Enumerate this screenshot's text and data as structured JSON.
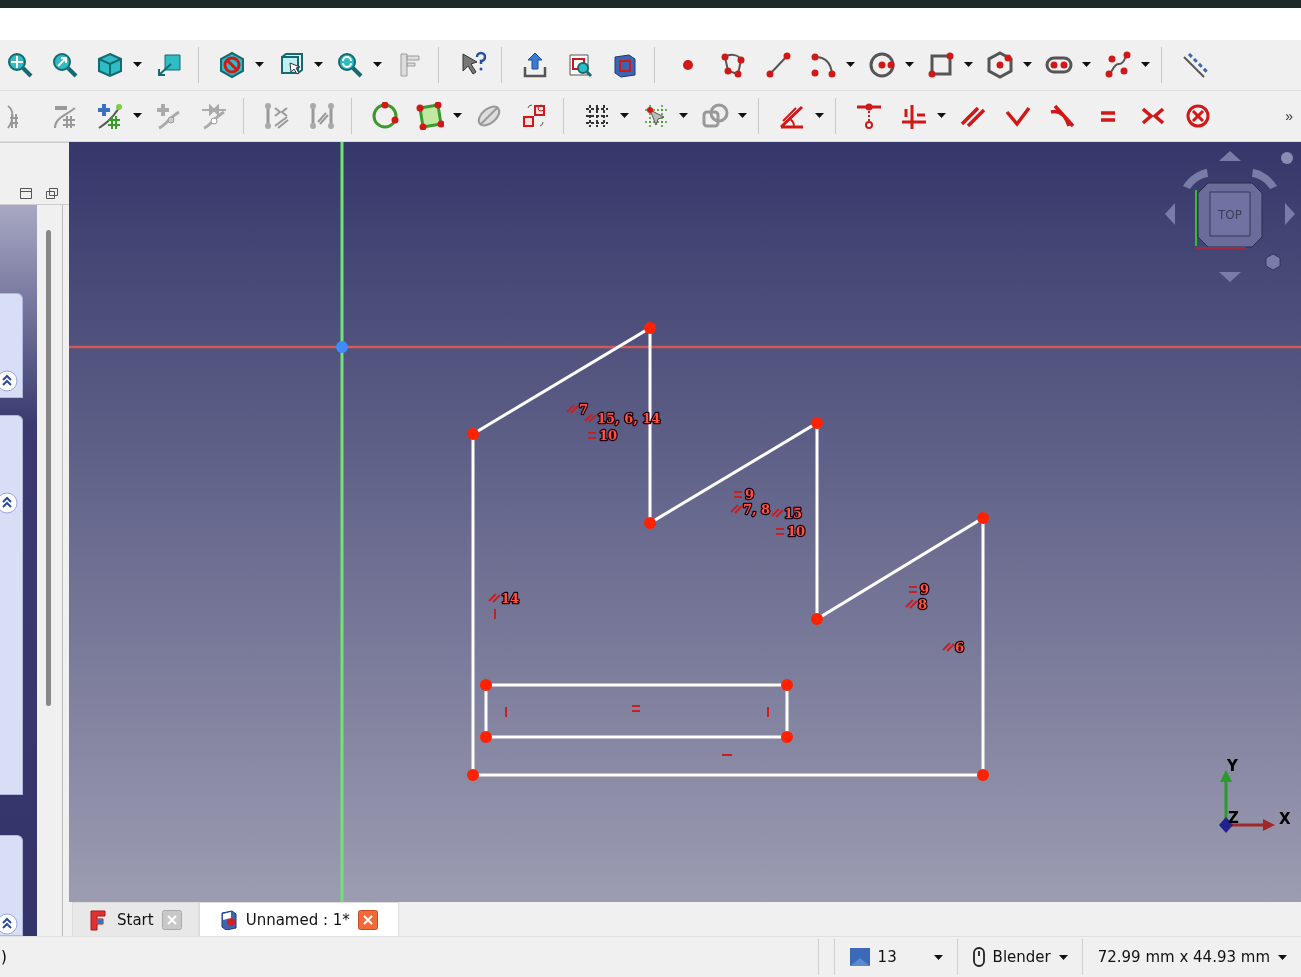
{
  "toolbar_overflow": "»",
  "sketch": {
    "constraints": [
      {
        "kind": "parallel",
        "label": "7"
      },
      {
        "kind": "parallel",
        "label": "15, 6, 14"
      },
      {
        "kind": "equal",
        "label": "10"
      },
      {
        "kind": "equal",
        "label": "9"
      },
      {
        "kind": "parallel",
        "label": "7, 8"
      },
      {
        "kind": "parallel",
        "label": "15"
      },
      {
        "kind": "equal",
        "label": "10"
      },
      {
        "kind": "equal",
        "label": "9"
      },
      {
        "kind": "parallel",
        "label": "14"
      },
      {
        "kind": "parallel",
        "label": "8"
      },
      {
        "kind": "vertical"
      },
      {
        "kind": "parallel",
        "label": "6"
      },
      {
        "kind": "vertical"
      },
      {
        "kind": "equal"
      },
      {
        "kind": "vertical"
      },
      {
        "kind": "horizontal"
      }
    ]
  },
  "navigation_cube": {
    "face": "TOP"
  },
  "axis_labels": [
    "Y",
    "Z",
    "X"
  ],
  "tabs": [
    {
      "label": "Start",
      "selected": false
    },
    {
      "label": "Unnamed : 1*",
      "selected": true
    }
  ],
  "status_bar": {
    "message": ")",
    "visibility_count": "13",
    "navigation_style": "Blender",
    "dimensions": "72.99 mm x 44.93 mm"
  }
}
